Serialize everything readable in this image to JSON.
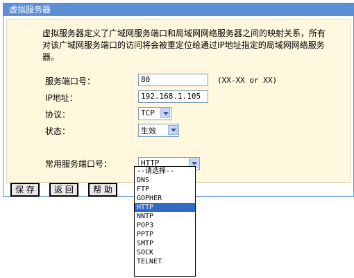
{
  "window": {
    "title": "虚拟服务器"
  },
  "description": "虚拟服务器定义了广域网服务端口和局域网网络服务器之间的映射关系，所有对该广域网服务端口的访问将会被重定位给通过IP地址指定的局域网网络服务器。",
  "form": {
    "port_label": "服务端口号：",
    "port_value": "80",
    "port_hint": "(XX-XX or XX)",
    "ip_label": "IP地址：",
    "ip_value": "192.168.1.105",
    "protocol_label": "协议：",
    "protocol_value": "TCP",
    "status_label": "状态：",
    "status_value": "生效",
    "common_port_label": "常用服务端口号：",
    "common_port_value": "HTTP"
  },
  "dropdown": {
    "options": [
      "--请选择--",
      "DNS",
      "FTP",
      "GOPHER",
      "HTTP",
      "NNTP",
      "POP3",
      "PPTP",
      "SMTP",
      "SOCK",
      "TELNET"
    ],
    "selected_index": 4,
    "highlight_color": "#316ac5"
  },
  "buttons": {
    "save": "保 存",
    "back": "返 回",
    "help": "帮 助"
  },
  "colors": {
    "title_bar": "#5c8fd6",
    "content_bg": "#fff8df"
  }
}
